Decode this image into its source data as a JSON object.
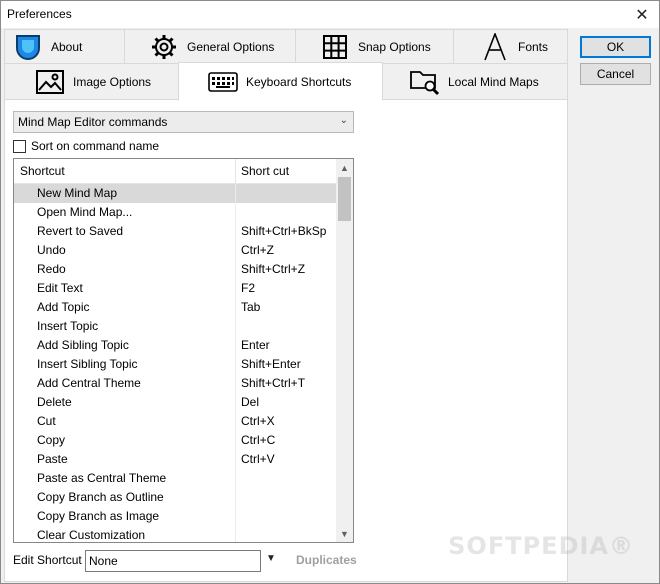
{
  "window": {
    "title": "Preferences"
  },
  "tabs_row1": [
    {
      "label": "About",
      "icon": "drop-icon"
    },
    {
      "label": "General Options",
      "icon": "gear-icon"
    },
    {
      "label": "Snap Options",
      "icon": "grid-icon"
    },
    {
      "label": "Fonts",
      "icon": "letter-a-icon"
    }
  ],
  "tabs_row2": [
    {
      "label": "Image Options",
      "icon": "image-icon"
    },
    {
      "label": "Keyboard Shortcuts",
      "icon": "keyboard-icon",
      "active": true
    },
    {
      "label": "Local Mind Maps",
      "icon": "folder-wrench-icon"
    }
  ],
  "buttons": {
    "ok": "OK",
    "cancel": "Cancel"
  },
  "command_set": {
    "selected": "Mind Map Editor commands"
  },
  "sort_checkbox": {
    "label": "Sort on command name",
    "checked": false
  },
  "list": {
    "columns": [
      "Shortcut",
      "Short cut"
    ],
    "rows": [
      {
        "name": "New Mind Map",
        "key": "",
        "selected": true
      },
      {
        "name": "Open Mind Map...",
        "key": ""
      },
      {
        "name": "Revert to Saved",
        "key": "Shift+Ctrl+BkSp"
      },
      {
        "name": "Undo",
        "key": "Ctrl+Z"
      },
      {
        "name": "Redo",
        "key": "Shift+Ctrl+Z"
      },
      {
        "name": "Edit Text",
        "key": "F2"
      },
      {
        "name": "Add Topic",
        "key": "Tab"
      },
      {
        "name": "Insert Topic",
        "key": ""
      },
      {
        "name": "Add Sibling Topic",
        "key": "Enter"
      },
      {
        "name": "Insert Sibling Topic",
        "key": "Shift+Enter"
      },
      {
        "name": "Add Central Theme",
        "key": "Shift+Ctrl+T"
      },
      {
        "name": "Delete",
        "key": "Del"
      },
      {
        "name": "Cut",
        "key": "Ctrl+X"
      },
      {
        "name": "Copy",
        "key": "Ctrl+C"
      },
      {
        "name": "Paste",
        "key": "Ctrl+V"
      },
      {
        "name": "Paste as Central Theme",
        "key": ""
      },
      {
        "name": "Copy Branch as Outline",
        "key": ""
      },
      {
        "name": "Copy Branch as Image",
        "key": ""
      },
      {
        "name": "Clear Customization",
        "key": ""
      }
    ]
  },
  "edit_shortcut": {
    "label": "Edit Shortcut",
    "value": "None",
    "duplicates": "Duplicates"
  },
  "watermark": "SOFTPEDIA"
}
